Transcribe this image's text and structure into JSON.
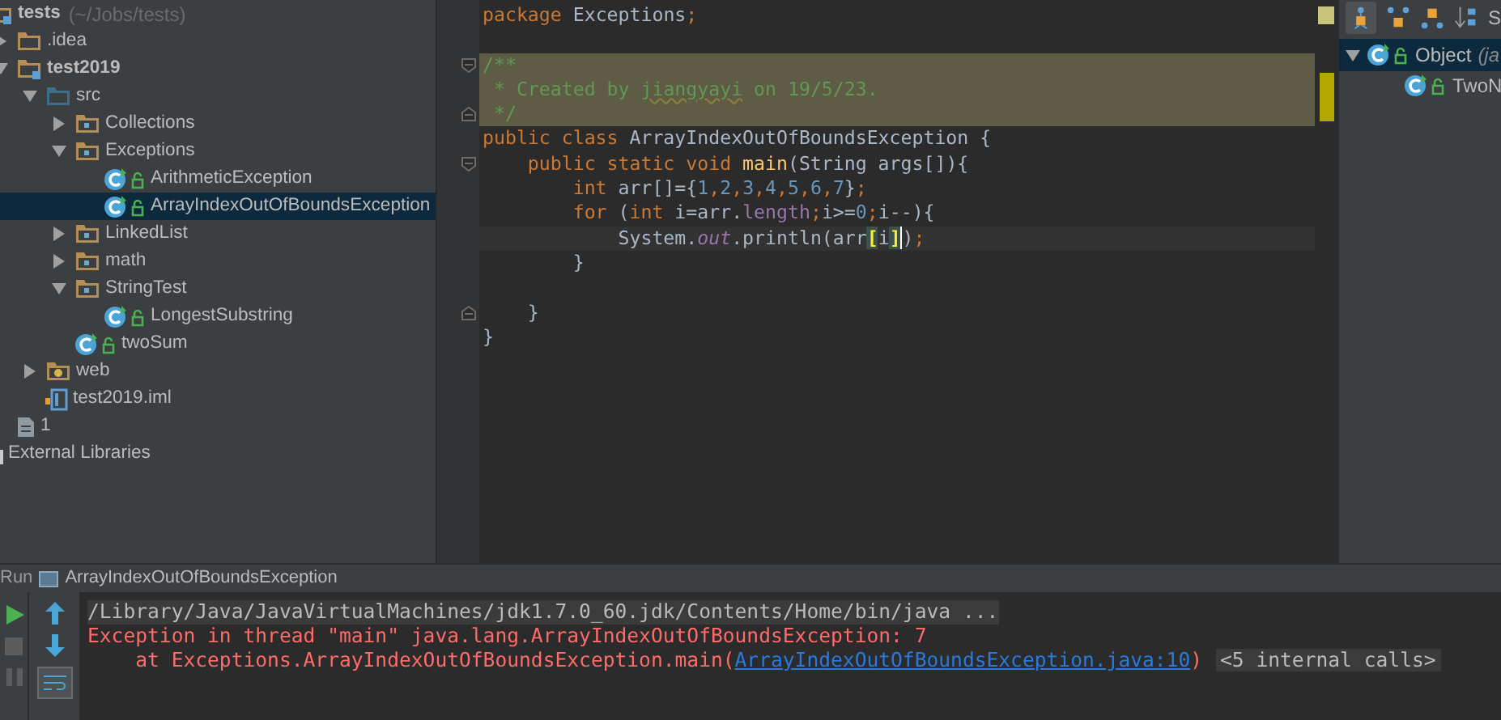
{
  "project_tree": [
    {
      "label": "tests",
      "path": "(~/Jobs/tests)",
      "kind": "module",
      "selected": false,
      "children": [
        {
          "label": ".idea",
          "kind": "folder",
          "expanded": false,
          "selected": false
        },
        {
          "label": "test2019",
          "kind": "module",
          "expanded": true,
          "selected": false,
          "children": [
            {
              "label": "src",
              "kind": "source",
              "expanded": true,
              "selected": false,
              "children": [
                {
                  "label": "Collections",
                  "kind": "package",
                  "expanded": false,
                  "selected": false
                },
                {
                  "label": "Exceptions",
                  "kind": "package",
                  "expanded": true,
                  "selected": false,
                  "children": [
                    {
                      "label": "ArithmeticException",
                      "kind": "class",
                      "selected": false
                    },
                    {
                      "label": "ArrayIndexOutOfBoundsException",
                      "kind": "class",
                      "selected": true
                    }
                  ]
                },
                {
                  "label": "LinkedList",
                  "kind": "package",
                  "expanded": false,
                  "selected": false
                },
                {
                  "label": "math",
                  "kind": "package",
                  "expanded": false,
                  "selected": false
                },
                {
                  "label": "StringTest",
                  "kind": "package",
                  "expanded": true,
                  "selected": false,
                  "children": [
                    {
                      "label": "LongestSubstring",
                      "kind": "class",
                      "selected": false
                    }
                  ]
                },
                {
                  "label": "twoSum",
                  "kind": "class",
                  "selected": false
                }
              ]
            },
            {
              "label": "web",
              "kind": "web",
              "expanded": false,
              "selected": false
            },
            {
              "label": "test2019.iml",
              "kind": "iml",
              "selected": false
            }
          ]
        },
        {
          "label": "1",
          "kind": "file",
          "selected": false
        }
      ]
    },
    {
      "label": "External Libraries",
      "kind": "library",
      "selected": false
    }
  ],
  "editor": {
    "lines": [
      {
        "kind": "plain",
        "fold_start": false,
        "fold_end": false,
        "tokens": [
          {
            "kind": "keyword",
            "text": "package"
          },
          {
            "kind": "plain",
            "text": " Exceptions"
          },
          {
            "kind": "keyword",
            "text": ";"
          }
        ]
      },
      {
        "kind": "plain",
        "fold_start": false,
        "fold_end": false
      },
      {
        "kind": "comment",
        "fold_start": true,
        "fold_end": false,
        "tokens": [
          {
            "kind": "comment",
            "text": "/**"
          }
        ]
      },
      {
        "kind": "comment",
        "fold_start": false,
        "fold_end": false,
        "tokens": [
          {
            "kind": "comment",
            "text": " * Created by "
          },
          {
            "kind": "typo",
            "text": "jiangyayi"
          },
          {
            "kind": "comment",
            "text": " on 19/5/23."
          }
        ]
      },
      {
        "kind": "comment",
        "fold_start": false,
        "fold_end": true,
        "tokens": [
          {
            "kind": "comment",
            "text": " */"
          }
        ]
      },
      {
        "kind": "plain",
        "fold_start": false,
        "fold_end": false,
        "tokens": [
          {
            "kind": "keyword",
            "text": "public class"
          },
          {
            "kind": "plain",
            "text": " ArrayIndexOutOfBoundsException {"
          }
        ]
      },
      {
        "kind": "plain",
        "fold_start": true,
        "fold_end": false,
        "tokens": [
          {
            "kind": "keyword",
            "text": "    public static void"
          },
          {
            "kind": "method",
            "text": " main"
          },
          {
            "kind": "plain",
            "text": "(String args[]){"
          }
        ]
      },
      {
        "kind": "plain",
        "fold_start": false,
        "fold_end": false,
        "tokens": [
          {
            "kind": "keyword",
            "text": "        int"
          },
          {
            "kind": "plain",
            "text": " arr[]={"
          },
          {
            "kind": "number",
            "text": "1"
          },
          {
            "kind": "keyword",
            "text": ","
          },
          {
            "kind": "number",
            "text": "2"
          },
          {
            "kind": "keyword",
            "text": ","
          },
          {
            "kind": "number",
            "text": "3"
          },
          {
            "kind": "keyword",
            "text": ","
          },
          {
            "kind": "number",
            "text": "4"
          },
          {
            "kind": "keyword",
            "text": ","
          },
          {
            "kind": "number",
            "text": "5"
          },
          {
            "kind": "keyword",
            "text": ","
          },
          {
            "kind": "number",
            "text": "6"
          },
          {
            "kind": "keyword",
            "text": ","
          },
          {
            "kind": "number",
            "text": "7"
          },
          {
            "kind": "plain",
            "text": "}"
          },
          {
            "kind": "keyword",
            "text": ";"
          }
        ]
      },
      {
        "kind": "plain",
        "fold_start": false,
        "fold_end": false,
        "tokens": [
          {
            "kind": "keyword",
            "text": "        for"
          },
          {
            "kind": "plain",
            "text": " ("
          },
          {
            "kind": "keyword",
            "text": "int"
          },
          {
            "kind": "plain",
            "text": " i=arr."
          },
          {
            "kind": "field",
            "text": "length"
          },
          {
            "kind": "keyword",
            "text": ";"
          },
          {
            "kind": "plain",
            "text": "i>="
          },
          {
            "kind": "number",
            "text": "0"
          },
          {
            "kind": "keyword",
            "text": ";"
          },
          {
            "kind": "plain",
            "text": "i--){"
          }
        ]
      },
      {
        "kind": "current",
        "fold_start": false,
        "fold_end": false,
        "tokens": [
          {
            "kind": "plain",
            "text": "            System."
          },
          {
            "kind": "static",
            "text": "out"
          },
          {
            "kind": "plain",
            "text": ".println(arr"
          },
          {
            "kind": "brace",
            "text": "["
          },
          {
            "kind": "plain",
            "text": "i"
          },
          {
            "kind": "brace",
            "text": "]"
          },
          {
            "kind": "caret",
            "text": ")"
          },
          {
            "kind": "keyword",
            "text": ";"
          }
        ]
      },
      {
        "kind": "plain",
        "fold_start": false,
        "fold_end": false,
        "tokens": [
          {
            "kind": "plain",
            "text": "        }"
          }
        ]
      },
      {
        "kind": "plain",
        "fold_start": false,
        "fold_end": false
      },
      {
        "kind": "plain",
        "fold_start": false,
        "fold_end": true,
        "tokens": [
          {
            "kind": "plain",
            "text": "    }"
          }
        ]
      },
      {
        "kind": "plain",
        "fold_start": false,
        "fold_end": false,
        "tokens": [
          {
            "kind": "plain",
            "text": "}"
          }
        ]
      }
    ]
  },
  "hierarchy": {
    "toolbar_text": "S",
    "rows": [
      {
        "label": "Object",
        "detail": "(ja",
        "expanded": true,
        "selected": true,
        "children": [
          {
            "label": "TwoN",
            "selected": false
          }
        ]
      }
    ]
  },
  "run_panel": {
    "title": "Run",
    "tab": "ArrayIndexOutOfBoundsException",
    "lines": [
      {
        "kind": "command",
        "tokens": [
          {
            "kind": "command",
            "text": "/Library/Java/JavaVirtualMachines/jdk1.7.0_60.jdk/Contents/Home/bin/java ..."
          }
        ]
      },
      {
        "kind": "error",
        "tokens": [
          {
            "kind": "error",
            "text": "Exception in thread \"main\" java.lang.ArrayIndexOutOfBoundsException: 7"
          }
        ]
      },
      {
        "kind": "error",
        "tokens": [
          {
            "kind": "error",
            "text": "    at Exceptions.ArrayIndexOutOfBoundsException.main("
          },
          {
            "kind": "link",
            "text": "ArrayIndexOutOfBoundsException.java:10"
          },
          {
            "kind": "error",
            "text": ")"
          },
          {
            "kind": "folded",
            "text": "<5 internal calls>"
          }
        ]
      }
    ]
  }
}
